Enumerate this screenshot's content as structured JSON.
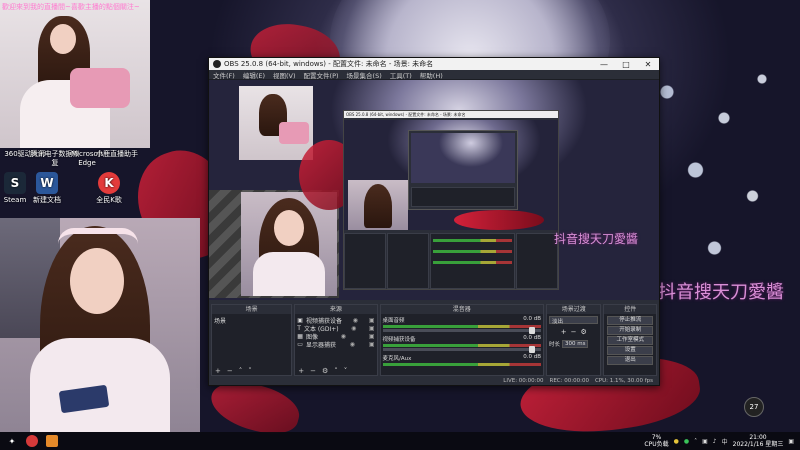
{
  "wallpaper": {
    "text_right": "抖音搜天刀愛醬",
    "text_mid": "抖音搜天刀愛醬"
  },
  "top_cam": {
    "caption": "歡迎來到我的直播間~喜歡主播的點個關注~"
  },
  "desktop_icons": [
    {
      "label": "360驱动大师",
      "glyph": "3",
      "color": "#2b6fd6"
    },
    {
      "label": "腾讯电子数据恢复",
      "glyph": "腾",
      "color": "#1aa260"
    },
    {
      "label": "Microsoft Edge",
      "glyph": "e",
      "color": "#1f7bd8"
    },
    {
      "label": "小鹿直播助手",
      "glyph": "鹿",
      "color": "#e84c8a"
    },
    {
      "label": "Steam",
      "glyph": "S",
      "color": "#1b2838"
    },
    {
      "label": "新建文档",
      "glyph": "W",
      "color": "#2b579a"
    },
    {
      "label": "全民K歌",
      "glyph": "K",
      "color": "#e33b3b"
    }
  ],
  "obs": {
    "title": "OBS 25.0.8 (64-bit, windows) - 配置文件: 未命名 - 场景: 未命名",
    "menu": [
      "文件(F)",
      "编辑(E)",
      "视图(V)",
      "配置文件(P)",
      "场景集合(S)",
      "工具(T)",
      "帮助(H)"
    ],
    "docks": {
      "scenes": {
        "title": "场景",
        "items": [
          "场景"
        ]
      },
      "sources": {
        "title": "来源",
        "items": [
          "视频捕获设备",
          "文本 (GDI+)",
          "图像",
          "显示器捕获"
        ]
      },
      "mixer": {
        "title": "混音器",
        "channels": [
          {
            "name": "桌面音频",
            "db": "0.0 dB"
          },
          {
            "name": "视频捕获设备",
            "db": "0.0 dB"
          },
          {
            "name": "麦克风/Aux",
            "db": "0.0 dB"
          }
        ]
      },
      "transitions": {
        "title": "场景过渡",
        "type": "淡出",
        "duration_label": "时长",
        "duration_value": "300 ms"
      },
      "controls": {
        "title": "控件",
        "buttons": [
          "停止推流",
          "开始录制",
          "工作室模式",
          "设置",
          "退出"
        ]
      }
    },
    "status": {
      "live": "LIVE: 00:00:00",
      "rec": "REC: 00:00:00",
      "cpu": "CPU: 1.1%, 30.00 fps"
    }
  },
  "nested_obs_title": "OBS 25.0.8 (64-bit, windows) - 配置文件: 未命名 - 场景: 未命名",
  "taskbar": {
    "tray_cpu": "7%",
    "tray_cpu_label": "CPU负载",
    "time": "21:00",
    "date": "2022/1/16 星期三"
  },
  "temp_badge": "27"
}
